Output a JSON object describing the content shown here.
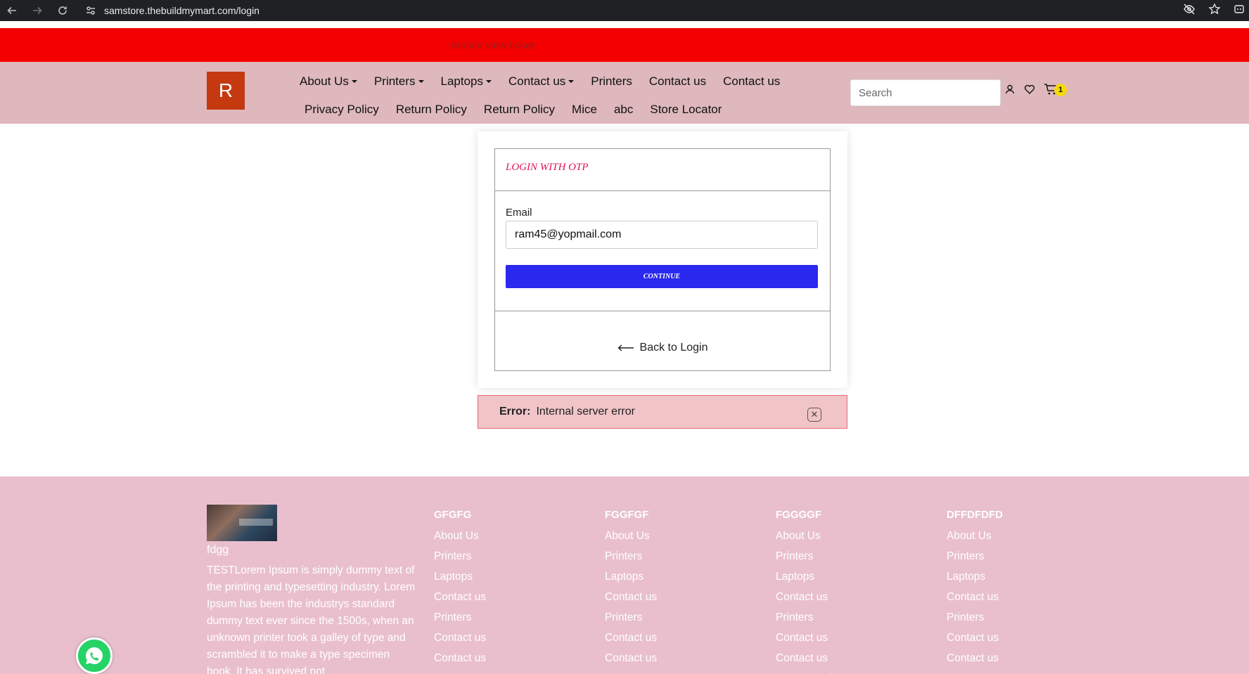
{
  "browser": {
    "url": "samstore.thebuildmymart.com/login"
  },
  "ticker": {
    "text": "mobile view ticker"
  },
  "header": {
    "logo_letter": "R",
    "menu_row1": [
      {
        "label": "About Us",
        "dropdown": true
      },
      {
        "label": "Printers",
        "dropdown": true
      },
      {
        "label": "Laptops",
        "dropdown": true
      },
      {
        "label": "Contact us",
        "dropdown": true
      },
      {
        "label": "Printers",
        "dropdown": false
      },
      {
        "label": "Contact us",
        "dropdown": false
      },
      {
        "label": "Contact us",
        "dropdown": false
      }
    ],
    "menu_row2": [
      {
        "label": "Privacy Policy"
      },
      {
        "label": "Return Policy"
      },
      {
        "label": "Return Policy"
      },
      {
        "label": "Mice"
      },
      {
        "label": "abc"
      },
      {
        "label": "Store Locator"
      }
    ],
    "search_placeholder": "Search",
    "cart_count": "1"
  },
  "login": {
    "title": "LOGIN WITH OTP",
    "email_label": "Email",
    "email_value": "ram45@yopmail.com",
    "continue_label": "CONTINUE",
    "back_label": "Back to Login"
  },
  "error": {
    "prefix": "Error:",
    "message": "Internal server error"
  },
  "footer": {
    "title": "fdgg",
    "description": "TESTLorem Ipsum is simply dummy text of the printing and typesetting industry. Lorem Ipsum has been the industrys standard dummy text ever since the 1500s, when an unknown printer took a galley of type and scrambled it to make a type specimen book. It has survived not",
    "columns": [
      {
        "heading": "GFGFG",
        "links": [
          "About Us",
          "Printers",
          "Laptops",
          "Contact us",
          "Printers",
          "Contact us",
          "Contact us",
          "Privacy Policy"
        ]
      },
      {
        "heading": "FGGFGF",
        "links": [
          "About Us",
          "Printers",
          "Laptops",
          "Contact us",
          "Printers",
          "Contact us",
          "Contact us",
          "Privacy Policy"
        ]
      },
      {
        "heading": "FGGGGF",
        "links": [
          "About Us",
          "Printers",
          "Laptops",
          "Contact us",
          "Printers",
          "Contact us",
          "Contact us",
          "Privacy Policy"
        ]
      },
      {
        "heading": "DFFDFDFD",
        "links": [
          "About Us",
          "Printers",
          "Laptops",
          "Contact us",
          "Printers",
          "Contact us",
          "Contact us",
          "Privacy Policy"
        ]
      }
    ]
  },
  "colors": {
    "ticker_bg": "#f50000",
    "header_bg": "#deb8bc",
    "logo_bg": "#c4390f",
    "continue_bg": "#2b28f0",
    "title_color": "#e0155d",
    "error_bg": "#f1c4c8",
    "footer_bg": "#e9bfcd"
  }
}
